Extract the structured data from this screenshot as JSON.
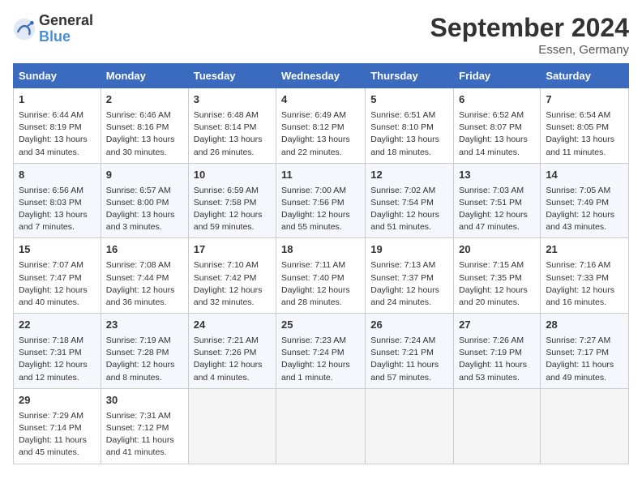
{
  "header": {
    "logo_general": "General",
    "logo_blue": "Blue",
    "title": "September 2024",
    "location": "Essen, Germany"
  },
  "weekdays": [
    "Sunday",
    "Monday",
    "Tuesday",
    "Wednesday",
    "Thursday",
    "Friday",
    "Saturday"
  ],
  "weeks": [
    [
      {
        "day": "1",
        "lines": [
          "Sunrise: 6:44 AM",
          "Sunset: 8:19 PM",
          "Daylight: 13 hours",
          "and 34 minutes."
        ]
      },
      {
        "day": "2",
        "lines": [
          "Sunrise: 6:46 AM",
          "Sunset: 8:16 PM",
          "Daylight: 13 hours",
          "and 30 minutes."
        ]
      },
      {
        "day": "3",
        "lines": [
          "Sunrise: 6:48 AM",
          "Sunset: 8:14 PM",
          "Daylight: 13 hours",
          "and 26 minutes."
        ]
      },
      {
        "day": "4",
        "lines": [
          "Sunrise: 6:49 AM",
          "Sunset: 8:12 PM",
          "Daylight: 13 hours",
          "and 22 minutes."
        ]
      },
      {
        "day": "5",
        "lines": [
          "Sunrise: 6:51 AM",
          "Sunset: 8:10 PM",
          "Daylight: 13 hours",
          "and 18 minutes."
        ]
      },
      {
        "day": "6",
        "lines": [
          "Sunrise: 6:52 AM",
          "Sunset: 8:07 PM",
          "Daylight: 13 hours",
          "and 14 minutes."
        ]
      },
      {
        "day": "7",
        "lines": [
          "Sunrise: 6:54 AM",
          "Sunset: 8:05 PM",
          "Daylight: 13 hours",
          "and 11 minutes."
        ]
      }
    ],
    [
      {
        "day": "8",
        "lines": [
          "Sunrise: 6:56 AM",
          "Sunset: 8:03 PM",
          "Daylight: 13 hours",
          "and 7 minutes."
        ]
      },
      {
        "day": "9",
        "lines": [
          "Sunrise: 6:57 AM",
          "Sunset: 8:00 PM",
          "Daylight: 13 hours",
          "and 3 minutes."
        ]
      },
      {
        "day": "10",
        "lines": [
          "Sunrise: 6:59 AM",
          "Sunset: 7:58 PM",
          "Daylight: 12 hours",
          "and 59 minutes."
        ]
      },
      {
        "day": "11",
        "lines": [
          "Sunrise: 7:00 AM",
          "Sunset: 7:56 PM",
          "Daylight: 12 hours",
          "and 55 minutes."
        ]
      },
      {
        "day": "12",
        "lines": [
          "Sunrise: 7:02 AM",
          "Sunset: 7:54 PM",
          "Daylight: 12 hours",
          "and 51 minutes."
        ]
      },
      {
        "day": "13",
        "lines": [
          "Sunrise: 7:03 AM",
          "Sunset: 7:51 PM",
          "Daylight: 12 hours",
          "and 47 minutes."
        ]
      },
      {
        "day": "14",
        "lines": [
          "Sunrise: 7:05 AM",
          "Sunset: 7:49 PM",
          "Daylight: 12 hours",
          "and 43 minutes."
        ]
      }
    ],
    [
      {
        "day": "15",
        "lines": [
          "Sunrise: 7:07 AM",
          "Sunset: 7:47 PM",
          "Daylight: 12 hours",
          "and 40 minutes."
        ]
      },
      {
        "day": "16",
        "lines": [
          "Sunrise: 7:08 AM",
          "Sunset: 7:44 PM",
          "Daylight: 12 hours",
          "and 36 minutes."
        ]
      },
      {
        "day": "17",
        "lines": [
          "Sunrise: 7:10 AM",
          "Sunset: 7:42 PM",
          "Daylight: 12 hours",
          "and 32 minutes."
        ]
      },
      {
        "day": "18",
        "lines": [
          "Sunrise: 7:11 AM",
          "Sunset: 7:40 PM",
          "Daylight: 12 hours",
          "and 28 minutes."
        ]
      },
      {
        "day": "19",
        "lines": [
          "Sunrise: 7:13 AM",
          "Sunset: 7:37 PM",
          "Daylight: 12 hours",
          "and 24 minutes."
        ]
      },
      {
        "day": "20",
        "lines": [
          "Sunrise: 7:15 AM",
          "Sunset: 7:35 PM",
          "Daylight: 12 hours",
          "and 20 minutes."
        ]
      },
      {
        "day": "21",
        "lines": [
          "Sunrise: 7:16 AM",
          "Sunset: 7:33 PM",
          "Daylight: 12 hours",
          "and 16 minutes."
        ]
      }
    ],
    [
      {
        "day": "22",
        "lines": [
          "Sunrise: 7:18 AM",
          "Sunset: 7:31 PM",
          "Daylight: 12 hours",
          "and 12 minutes."
        ]
      },
      {
        "day": "23",
        "lines": [
          "Sunrise: 7:19 AM",
          "Sunset: 7:28 PM",
          "Daylight: 12 hours",
          "and 8 minutes."
        ]
      },
      {
        "day": "24",
        "lines": [
          "Sunrise: 7:21 AM",
          "Sunset: 7:26 PM",
          "Daylight: 12 hours",
          "and 4 minutes."
        ]
      },
      {
        "day": "25",
        "lines": [
          "Sunrise: 7:23 AM",
          "Sunset: 7:24 PM",
          "Daylight: 12 hours",
          "and 1 minute."
        ]
      },
      {
        "day": "26",
        "lines": [
          "Sunrise: 7:24 AM",
          "Sunset: 7:21 PM",
          "Daylight: 11 hours",
          "and 57 minutes."
        ]
      },
      {
        "day": "27",
        "lines": [
          "Sunrise: 7:26 AM",
          "Sunset: 7:19 PM",
          "Daylight: 11 hours",
          "and 53 minutes."
        ]
      },
      {
        "day": "28",
        "lines": [
          "Sunrise: 7:27 AM",
          "Sunset: 7:17 PM",
          "Daylight: 11 hours",
          "and 49 minutes."
        ]
      }
    ],
    [
      {
        "day": "29",
        "lines": [
          "Sunrise: 7:29 AM",
          "Sunset: 7:14 PM",
          "Daylight: 11 hours",
          "and 45 minutes."
        ]
      },
      {
        "day": "30",
        "lines": [
          "Sunrise: 7:31 AM",
          "Sunset: 7:12 PM",
          "Daylight: 11 hours",
          "and 41 minutes."
        ]
      },
      {
        "day": "",
        "lines": []
      },
      {
        "day": "",
        "lines": []
      },
      {
        "day": "",
        "lines": []
      },
      {
        "day": "",
        "lines": []
      },
      {
        "day": "",
        "lines": []
      }
    ]
  ]
}
